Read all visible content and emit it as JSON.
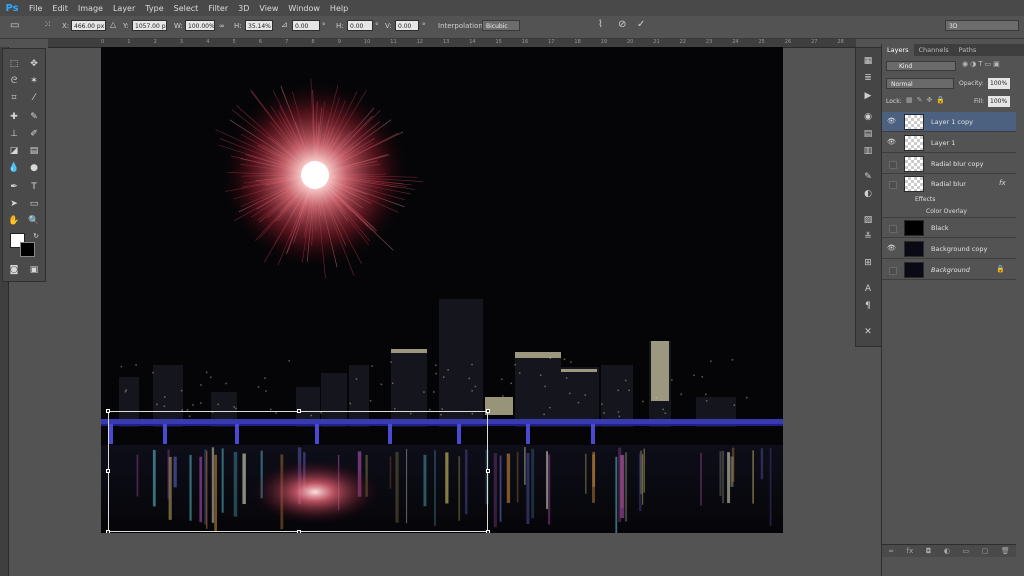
{
  "app_logo": "Ps",
  "menu": [
    "File",
    "Edit",
    "Image",
    "Layer",
    "Type",
    "Select",
    "Filter",
    "3D",
    "View",
    "Window",
    "Help"
  ],
  "options": {
    "x_label": "X:",
    "x_value": "466.00 px",
    "y_label": "Y:",
    "y_value": "1057.00 p",
    "w_label": "W:",
    "w_value": "100.00%",
    "h_label": "H:",
    "h_value": "35.14%",
    "rot_value": "0.00",
    "hskew_label": "H:",
    "hskew_value": "0.00",
    "vskew_label": "V:",
    "vskew_value": "0.00",
    "interp_label": "Interpolation:",
    "interp_value": "Bicubic",
    "workspace": "3D"
  },
  "ruler_top": [
    "0",
    "1",
    "2",
    "3",
    "4",
    "5",
    "6",
    "7",
    "8",
    "9",
    "10",
    "11",
    "12",
    "13",
    "14",
    "15",
    "16",
    "17",
    "18",
    "19",
    "20",
    "21",
    "22",
    "23",
    "24",
    "25",
    "26",
    "27",
    "28"
  ],
  "layers_panel": {
    "tabs": [
      "Layers",
      "Channels",
      "Paths"
    ],
    "kind": "Kind",
    "blend_mode": "Normal",
    "opacity_label": "Opacity:",
    "opacity_value": "100%",
    "lock_label": "Lock:",
    "fill_label": "Fill:",
    "fill_value": "100%",
    "layers": [
      {
        "name": "Layer 1 copy",
        "visible": true
      },
      {
        "name": "Layer 1",
        "visible": true
      },
      {
        "name": "Radial blur copy",
        "visible": false
      },
      {
        "name": "Radial blur",
        "visible": false,
        "fx": "fx"
      },
      {
        "name": "Black",
        "visible": false
      },
      {
        "name": "Background copy",
        "visible": true
      },
      {
        "name": "Background",
        "visible": false
      }
    ],
    "effects_label": "Effects",
    "color_overlay_label": "Color Overlay"
  }
}
